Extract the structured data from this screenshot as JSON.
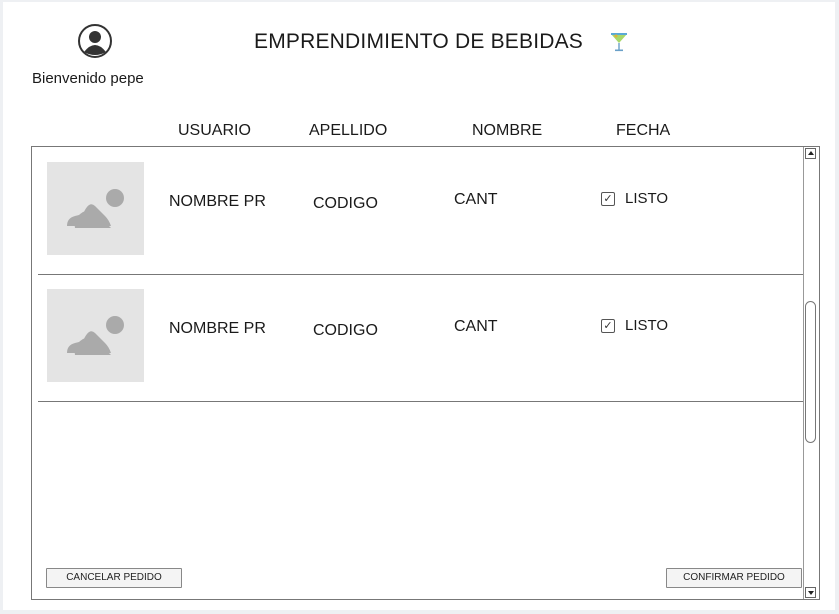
{
  "header": {
    "welcome": "Bienvenido pepe",
    "title": "EMPRENDIMIENTO DE BEBIDAS"
  },
  "columns": [
    "USUARIO",
    "APELLIDO",
    "NOMBRE",
    "FECHA"
  ],
  "rows": [
    {
      "name": "NOMBRE PR",
      "code": "CODIGO",
      "qty": "CANT",
      "status": "LISTO",
      "checked": true
    },
    {
      "name": "NOMBRE PR",
      "code": "CODIGO",
      "qty": "CANT",
      "status": "LISTO",
      "checked": true
    }
  ],
  "buttons": {
    "cancel": "CANCELAR PEDIDO",
    "confirm": "CONFIRMAR PEDIDO"
  },
  "icons": {
    "avatar": "user-avatar-icon",
    "drink": "cocktail-icon",
    "thumbnail": "image-placeholder-icon",
    "checkbox_mark": "✓"
  },
  "colors": {
    "placeholder_bg": "#e4e4e4",
    "placeholder_shape": "#aaaaaa",
    "border": "#777777"
  }
}
